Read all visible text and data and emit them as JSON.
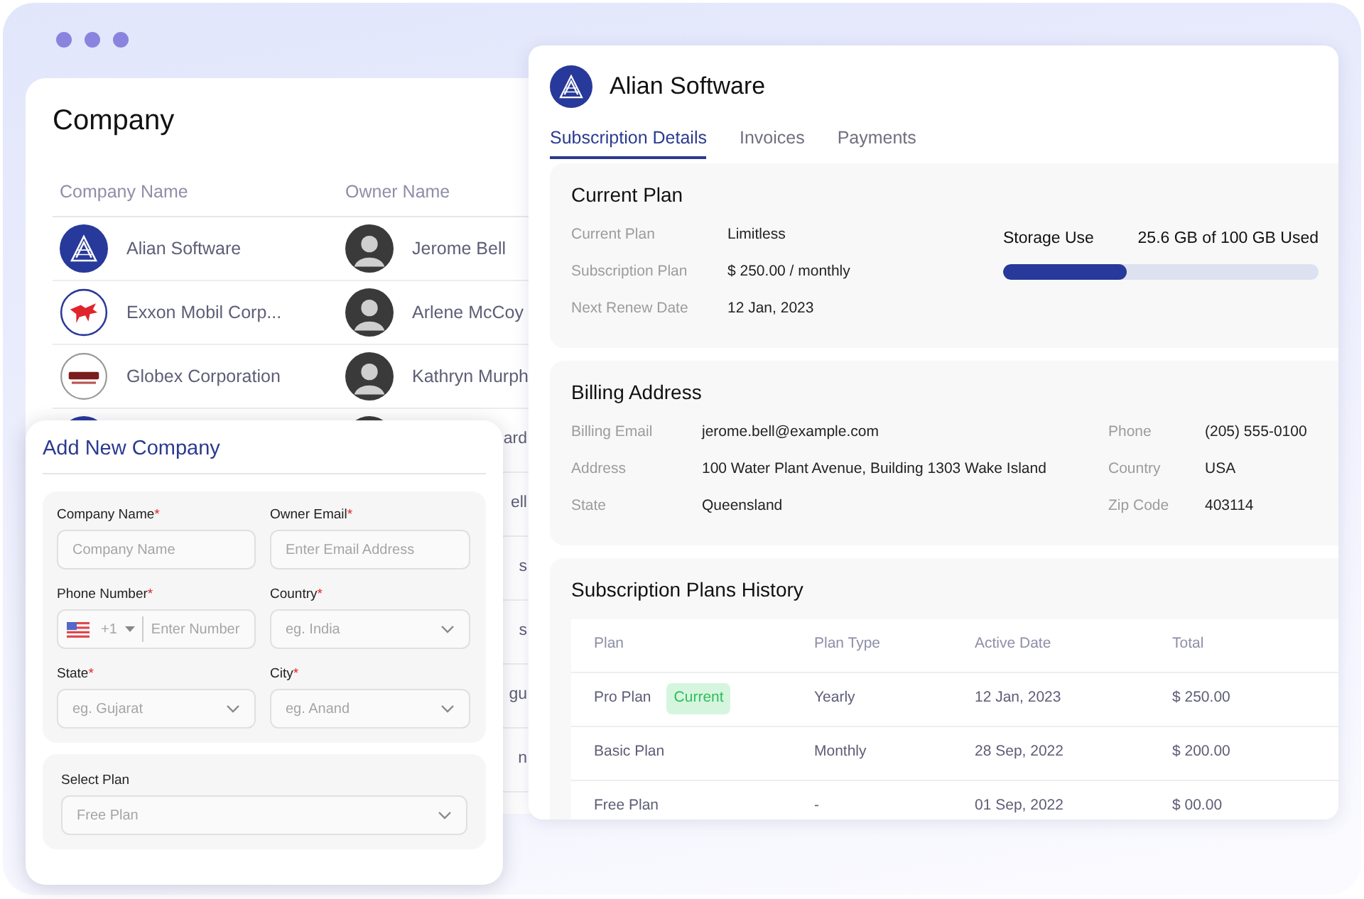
{
  "company_list": {
    "title": "Company",
    "columns": [
      "Company Name",
      "Owner Name"
    ],
    "rows": [
      {
        "kind": "alian",
        "company": "Alian Software",
        "owner": "Jerome Bell"
      },
      {
        "kind": "pegasus",
        "company": "Exxon Mobil Corp...",
        "owner": "Arlene McCoy"
      },
      {
        "kind": "globe",
        "company": "Globex Corporation",
        "owner": "Kathryn Murph"
      },
      {
        "kind": "alian",
        "owner": "ard"
      },
      {
        "owner": "ell"
      },
      {
        "owner": "s"
      },
      {
        "owner": "s"
      },
      {
        "owner": "gu"
      },
      {
        "owner": "n"
      }
    ]
  },
  "details": {
    "company": "Alian Software",
    "tabs": [
      {
        "label": "Subscription Details",
        "selected": true
      },
      {
        "label": "Invoices",
        "selected": false
      },
      {
        "label": "Payments",
        "selected": false
      }
    ],
    "current_plan": {
      "title": "Current Plan",
      "rows": [
        {
          "label": "Current Plan",
          "value": "Limitless"
        },
        {
          "label": "Subscription Plan",
          "value": "$ 250.00 / monthly"
        },
        {
          "label": "Next Renew Date",
          "value": "12 Jan, 2023"
        }
      ],
      "storage": {
        "label": "Storage Use",
        "reading": "25.6 GB of 100 GB Used",
        "level": 0.39
      }
    },
    "billing": {
      "title": "Billing Address",
      "left": [
        {
          "label": "Billing Email",
          "value": "jerome.bell@example.com"
        },
        {
          "label": "Address",
          "value": "100 Water Plant Avenue, Building 1303 Wake Island"
        },
        {
          "label": "State",
          "value": "Queensland"
        }
      ],
      "right": [
        {
          "label": "Phone",
          "value": "(205) 555-0100"
        },
        {
          "label": "Country",
          "value": "USA"
        },
        {
          "label": "Zip Code",
          "value": "403114"
        }
      ]
    },
    "history": {
      "title": "Subscription Plans History",
      "columns": [
        "Plan",
        "Plan Type",
        "Active Date",
        "Total"
      ],
      "rows": [
        {
          "plan": "Pro Plan",
          "badge": "Current",
          "type": "Yearly",
          "date": "12 Jan, 2023",
          "total": "$ 250.00"
        },
        {
          "plan": "Basic Plan",
          "type": "Monthly",
          "date": "28 Sep, 2022",
          "total": "$ 200.00"
        },
        {
          "plan": "Free Plan",
          "type": "-",
          "date": "01 Sep, 2022",
          "total": "$ 00.00"
        }
      ]
    }
  },
  "add_company": {
    "title": "Add New Company",
    "required_mark": "*",
    "fields": [
      {
        "kind": "text",
        "label": "Company Name",
        "required": true,
        "placeholder": "Company Name"
      },
      {
        "kind": "text",
        "label": "Owner Email",
        "required": true,
        "placeholder": "Enter Email Address"
      },
      {
        "kind": "phone",
        "label": "Phone Number",
        "required": true,
        "code": "+1",
        "placeholder": "Enter Number"
      },
      {
        "kind": "select",
        "label": "Country",
        "required": true,
        "placeholder": "eg. India"
      },
      {
        "kind": "select",
        "label": "State",
        "required": true,
        "placeholder": "eg. Gujarat"
      },
      {
        "kind": "select",
        "label": "City",
        "required": true,
        "placeholder": "eg. Anand"
      }
    ],
    "plan": {
      "label": "Select Plan",
      "placeholder": "Free Plan"
    }
  }
}
